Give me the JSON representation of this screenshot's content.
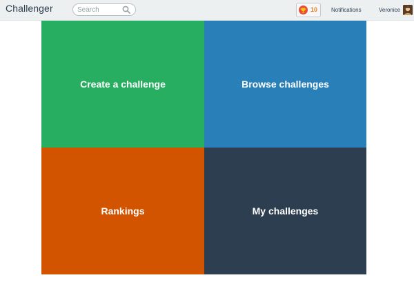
{
  "header": {
    "brand": "Challenger",
    "search_placeholder": "Search",
    "search_value": "",
    "points_value": "10",
    "notifications_label": "Notifications",
    "user_name": "Veronice"
  },
  "icons": {
    "search": "search-icon",
    "trophy": "trophy-icon",
    "avatar": "avatar"
  },
  "tiles": [
    {
      "label": "Create a challenge",
      "color": "#27ae60"
    },
    {
      "label": "Browse challenges",
      "color": "#2980b9"
    },
    {
      "label": "Rankings",
      "color": "#d35400"
    },
    {
      "label": "My challenges",
      "color": "#2c3e50"
    }
  ],
  "colors": {
    "header_bg": "#ecf0f1",
    "text_dark": "#2c3e50",
    "points_accent": "#e67e22",
    "badge_red": "#e74c3c"
  }
}
